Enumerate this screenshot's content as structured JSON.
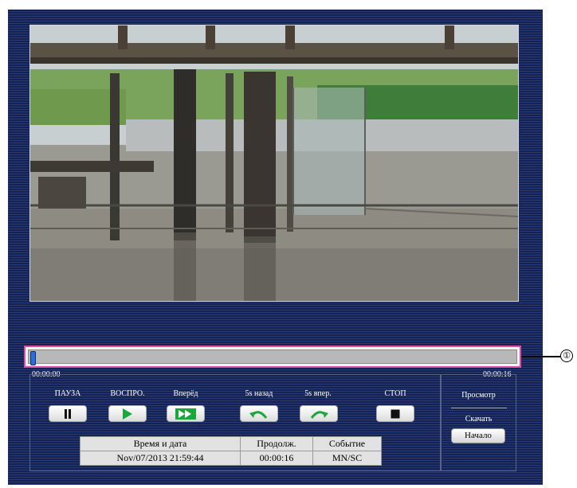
{
  "timeline": {
    "start_time": "00:00:00",
    "end_time": "00:00:16",
    "position": 0.0,
    "callout": "①"
  },
  "controls": {
    "pause": "ПАУЗА",
    "play": "ВОСПРО.",
    "forward": "Вперёд",
    "back5": "5s назад",
    "fwd5": "5s впер.",
    "stop": "СТОП"
  },
  "info_table": {
    "headers": [
      "Время и дата",
      "Продолж.",
      "Событие"
    ],
    "row": [
      "Nov/07/2013 21:59:44",
      "00:00:16",
      "MN/SC"
    ]
  },
  "side": {
    "view": "Просмотр",
    "download": "Скачать",
    "start": "Начало"
  },
  "colors": {
    "panel": "#1d2b5e",
    "highlight": "#e04aa0",
    "play_green": "#1aa83b"
  }
}
